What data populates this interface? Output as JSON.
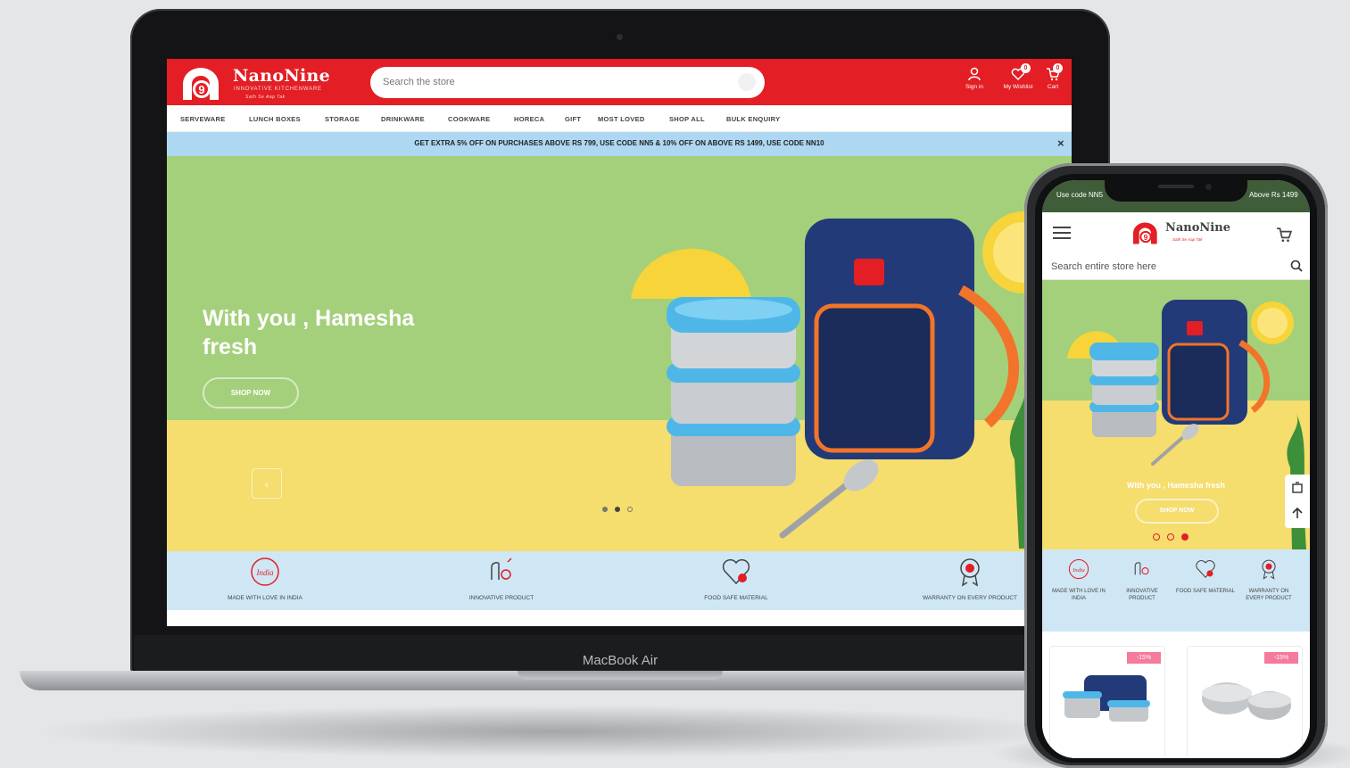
{
  "laptop": {
    "brand_label": "MacBook Air",
    "header": {
      "logo_name": "NanoNine",
      "logo_tagline": "INNOVATIVE KITCHENWARE",
      "logo_slogan": "Sath Se Aap Tak",
      "search_placeholder": "Search the store",
      "signin_label": "Sign in",
      "wishlist_label": "My Wishlist",
      "wishlist_count": "0",
      "cart_label": "Cart",
      "cart_count": "0",
      "accent_color": "#e31e24"
    },
    "nav": {
      "items": [
        "SERVEWARE",
        "LUNCH BOXES",
        "STORAGE",
        "DRINKWARE",
        "COOKWARE",
        "HORECA",
        "GIFT",
        "MOST LOVED",
        "SHOP ALL",
        "BULK ENQUIRY"
      ]
    },
    "promo": {
      "text": "GET EXTRA 5% OFF ON PURCHASES ABOVE RS 799, USE CODE NN5 & 10% OFF ON ABOVE RS 1499, USE CODE NN10",
      "close": "×"
    },
    "hero": {
      "title": "With you , Hamesha fresh",
      "button": "SHOP NOW",
      "prev_arrow": "‹",
      "slide_count": 3,
      "active_slide": 2
    },
    "features": [
      {
        "icon": "made-in-india-icon",
        "label": "MADE WITH LOVE IN INDIA"
      },
      {
        "icon": "innovative-product-icon",
        "label": "INNOVATIVE PRODUCT"
      },
      {
        "icon": "food-safe-heart-icon",
        "label": "FOOD SAFE MATERIAL"
      },
      {
        "icon": "warranty-badge-icon",
        "label": "WARRANTY ON EVERY PRODUCT"
      }
    ]
  },
  "phone": {
    "status_left": "Use code NN5",
    "status_right": "Above Rs 1499",
    "logo_name": "NanoNine",
    "logo_slogan": "Sath Se Aap Tak",
    "search_placeholder": "Search entire store here",
    "hero": {
      "title": "With you , Hamesha fresh",
      "button": "SHOP NOW",
      "slide_count": 3,
      "active_slide": 3
    },
    "features": [
      {
        "icon": "made-in-india-icon",
        "label": "MADE WITH LOVE IN INDIA"
      },
      {
        "icon": "innovative-product-icon",
        "label": "INNOVATIVE PRODUCT"
      },
      {
        "icon": "food-safe-heart-icon",
        "label": "FOOD SAFE MATERIAL"
      },
      {
        "icon": "warranty-badge-icon",
        "label": "WARRANTY ON EVERY PRODUCT"
      }
    ],
    "products": [
      {
        "badge": "-15%",
        "image": "lunch-box-bag-set"
      },
      {
        "badge": "-15%",
        "image": "steel-container-set"
      }
    ]
  },
  "colors": {
    "brand_red": "#e31e24",
    "hero_green": "#a4d07b",
    "hero_yellow": "#f5dd6e",
    "promo_blue": "#aed8f2",
    "feature_blue": "#cfe7f5",
    "lid_blue": "#4fb7e8",
    "bag_navy": "#233a78",
    "bag_orange": "#f2742a"
  }
}
